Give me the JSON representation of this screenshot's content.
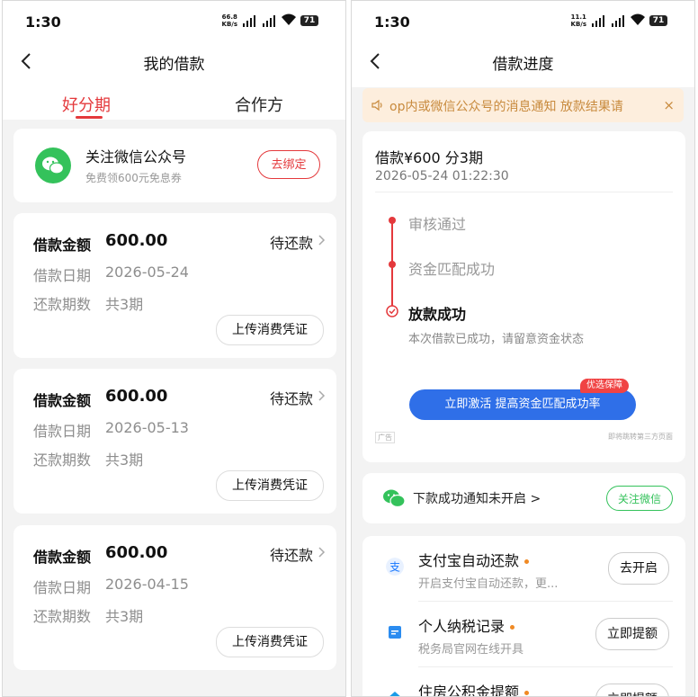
{
  "status": {
    "time": "1:30"
  },
  "left": {
    "status": {
      "speed_value": "66.8",
      "speed_unit": "KB/s",
      "battery": "71"
    },
    "nav": {
      "title": "我的借款"
    },
    "tabs": [
      {
        "label": "好分期"
      },
      {
        "label": "合作方"
      }
    ],
    "wechat_card": {
      "title": "关注微信公众号",
      "subtitle": "免费领600元免息券",
      "button": "去绑定"
    },
    "loans": [
      {
        "amount_label": "借款金额",
        "amount": "600.00",
        "status": "待还款",
        "date_label": "借款日期",
        "date": "2026-05-24",
        "periods_label": "还款期数",
        "periods": "共3期",
        "upload_button": "上传消费凭证"
      },
      {
        "amount_label": "借款金额",
        "amount": "600.00",
        "status": "待还款",
        "date_label": "借款日期",
        "date": "2026-05-13",
        "periods_label": "还款期数",
        "periods": "共3期",
        "upload_button": "上传消费凭证"
      },
      {
        "amount_label": "借款金额",
        "amount": "600.00",
        "status": "待还款",
        "date_label": "借款日期",
        "date": "2026-04-15",
        "periods_label": "还款期数",
        "periods": "共3期",
        "upload_button": "上传消费凭证"
      }
    ]
  },
  "right": {
    "status": {
      "speed_value": "11.1",
      "speed_unit": "KB/s",
      "battery": "71"
    },
    "nav": {
      "title": "借款进度"
    },
    "notice": {
      "text": "op内或微信公众号的消息通知    放款结果请",
      "close": "×"
    },
    "progress": {
      "title": "借款¥600 分3期",
      "datetime": "2026-05-24 01:22:30",
      "steps": [
        {
          "label": "审核通过"
        },
        {
          "label": "资金匹配成功"
        },
        {
          "label": "放款成功"
        }
      ],
      "final_sub": "本次借款已成功，请留意资金状态",
      "activate_button": "立即激活 提高资金匹配成功率",
      "badge": "优选保障",
      "ad_tag": "广告",
      "ad_note": "即将跳转第三方页面"
    },
    "wechat_notice": {
      "text": "下款成功通知未开启 >",
      "button": "关注微信"
    },
    "services": [
      {
        "title": "支付宝自动还款",
        "subtitle": "开启支付宝自动还款，更...",
        "button": "去开启",
        "color": "#1677ff"
      },
      {
        "title": "个人纳税记录",
        "subtitle": "税务局官网在线开具",
        "button": "立即提额",
        "color": "#2b8cf0"
      },
      {
        "title": "住房公积金提额",
        "subtitle": "",
        "button": "立即提额",
        "color": "#1a9be8"
      }
    ]
  }
}
